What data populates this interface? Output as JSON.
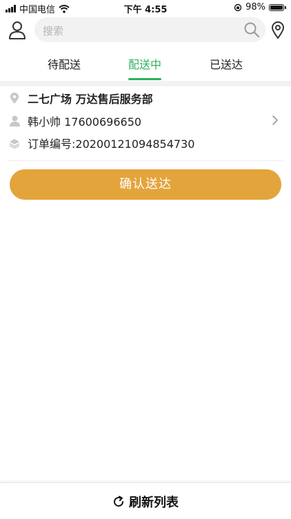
{
  "status_bar": {
    "carrier": "中国电信",
    "time": "下午 4:55",
    "battery": "98%",
    "battery_level": 0.98
  },
  "header": {
    "search_placeholder": "搜索",
    "user_icon": "user-icon",
    "location_icon": "location-pin-icon"
  },
  "tabs": [
    {
      "label": "待配送"
    },
    {
      "label": "配送中"
    },
    {
      "label": "已送达"
    }
  ],
  "active_tab": "配送中",
  "order": {
    "address": "二七广场 万达售后服务部",
    "contact": "韩小帅 17600696650",
    "order_no": "订单编号:20200121094854730"
  },
  "confirm_button": "确认送达",
  "refresh_button": "刷新列表",
  "colors": {
    "accent_green": "#2bb25c",
    "button_orange": "#e4a43c",
    "icon_gray": "#c8c8c8"
  }
}
